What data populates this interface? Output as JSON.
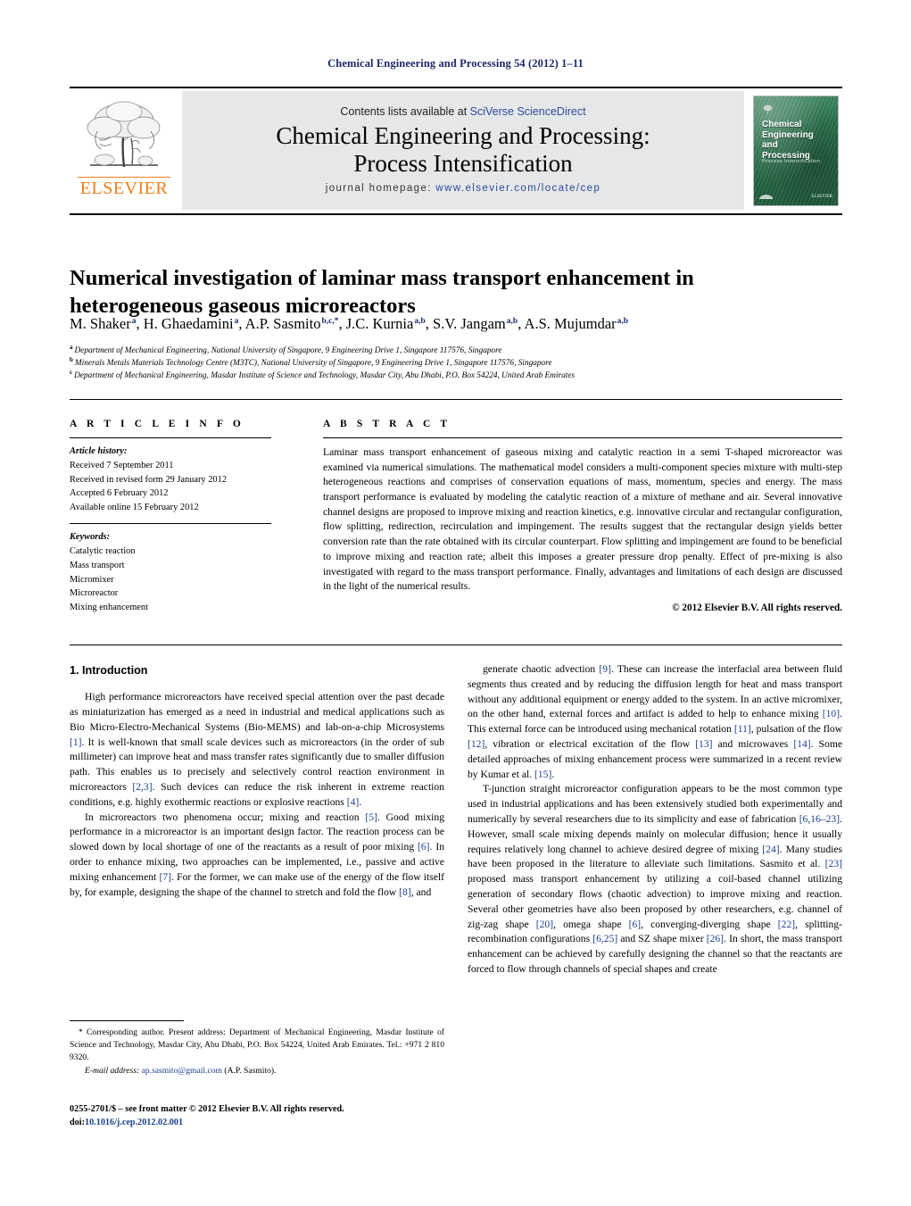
{
  "running_head": "Chemical Engineering and Processing 54 (2012) 1–11",
  "masthead": {
    "publisher_name": "ELSEVIER",
    "contents_prefix": "Contents lists available at ",
    "contents_link": "SciVerse ScienceDirect",
    "journal_title_line1": "Chemical Engineering and Processing:",
    "journal_title_line2": "Process Intensification",
    "homepage_label": "journal homepage:",
    "homepage_url": "www.elsevier.com/locate/cep",
    "cover": {
      "title_line1": "Chemical",
      "title_line2": "Engineering",
      "title_line3": "and",
      "title_line4": "Processing",
      "subtitle": "Process Intensification",
      "imprint": "ELSEVIER",
      "bg_color": "#2c7a52"
    }
  },
  "article": {
    "title": "Numerical investigation of laminar mass transport enhancement in heterogeneous gaseous microreactors",
    "authors_html": "M. Shaker<sup>a</sup>, H. Ghaedamini<sup>a</sup>, A.P. Sasmito<sup>b,c,*</sup>, J.C. Kurnia<sup>a,b</sup>, S.V. Jangam<sup>a,b</sup>, A.S. Mujumdar<sup>a,b</sup>",
    "affiliations": [
      {
        "marker": "a",
        "text": "Department of Mechanical Engineering, National University of Singapore, 9 Engineering Drive 1, Singapore 117576, Singapore"
      },
      {
        "marker": "b",
        "text": "Minerals Metals Materials Technology Centre (M3TC), National University of Singapore, 9 Engineering Drive 1, Singapore 117576, Singapore"
      },
      {
        "marker": "c",
        "text": "Department of Mechanical Engineering, Masdar Institute of Science and Technology, Masdar City, Abu Dhabi, P.O. Box 54224, United Arab Emirates"
      }
    ]
  },
  "article_info": {
    "heading": "A R T I C L E    I N F O",
    "history_label": "Article history:",
    "history": [
      "Received 7 September 2011",
      "Received in revised form 29 January 2012",
      "Accepted 6 February 2012",
      "Available online 15 February 2012"
    ],
    "keywords_label": "Keywords:",
    "keywords": [
      "Catalytic reaction",
      "Mass transport",
      "Micromixer",
      "Microreactor",
      "Mixing enhancement"
    ]
  },
  "abstract": {
    "heading": "A B S T R A C T",
    "text": "Laminar mass transport enhancement of gaseous mixing and catalytic reaction in a semi T-shaped microreactor was examined via numerical simulations. The mathematical model considers a multi-component species mixture with multi-step heterogeneous reactions and comprises of conservation equations of mass, momentum, species and energy. The mass transport performance is evaluated by modeling the catalytic reaction of a mixture of methane and air. Several innovative channel designs are proposed to improve mixing and reaction kinetics, e.g. innovative circular and rectangular configuration, flow splitting, redirection, recirculation and impingement. The results suggest that the rectangular design yields better conversion rate than the rate obtained with its circular counterpart. Flow splitting and impingement are found to be beneficial to improve mixing and reaction rate; albeit this imposes a greater pressure drop penalty. Effect of pre-mixing is also investigated with regard to the mass transport performance. Finally, advantages and limitations of each design are discussed in the light of the numerical results.",
    "copyright": "© 2012 Elsevier B.V. All rights reserved."
  },
  "body": {
    "section_number_title": "1.  Introduction",
    "left_paragraphs": [
      "High performance microreactors have received special attention over the past decade as miniaturization has emerged as a need in industrial and medical applications such as Bio Micro-Electro-Mechanical Systems (Bio-MEMS) and lab-on-a-chip Microsystems [1]. It is well-known that small scale devices such as microreactors (in the order of sub millimeter) can improve heat and mass transfer rates significantly due to smaller diffusion path. This enables us to precisely and selectively control reaction environment in microreactors [2,3]. Such devices can reduce the risk inherent in extreme reaction conditions, e.g. highly exothermic reactions or explosive reactions [4].",
      "In microreactors two phenomena occur; mixing and reaction [5]. Good mixing performance in a microreactor is an important design factor. The reaction process can be slowed down by local shortage of one of the reactants as a result of poor mixing [6]. In order to enhance mixing, two approaches can be implemented, i.e., passive and active mixing enhancement [7]. For the former, we can make use of the energy of the flow itself by, for example, designing the shape of the channel to stretch and fold the flow [8], and"
    ],
    "right_paragraphs": [
      "generate chaotic advection [9]. These can increase the interfacial area between fluid segments thus created and by reducing the diffusion length for heat and mass transport without any additional equipment or energy added to the system. In an active micromixer, on the other hand, external forces and artifact is added to help to enhance mixing [10]. This external force can be introduced using mechanical rotation [11], pulsation of the flow [12], vibration or electrical excitation of the flow [13] and microwaves [14]. Some detailed approaches of mixing enhancement process were summarized in a recent review by Kumar et al. [15].",
      "T-junction straight microreactor configuration appears to be the most common type used in industrial applications and has been extensively studied both experimentally and numerically by several researchers due to its simplicity and ease of fabrication [6,16–23]. However, small scale mixing depends mainly on molecular diffusion; hence it usually requires relatively long channel to achieve desired degree of mixing [24]. Many studies have been proposed in the literature to alleviate such limitations. Sasmito et al. [23] proposed mass transport enhancement by utilizing a coil-based channel utilizing generation of secondary flows (chaotic advection) to improve mixing and reaction. Several other geometries have also been proposed by other researchers, e.g. channel of zig-zag shape [20], omega shape [6], converging-diverging shape [22], splitting-recombination configurations [6,25] and SZ shape mixer [26]. In short, the mass transport enhancement can be achieved by carefully designing the channel so that the reactants are forced to flow through channels of special shapes and create"
    ]
  },
  "footnote": {
    "corresponding": "* Corresponding author. Present address: Department of Mechanical Engineering, Masdar Institute of Science and Technology, Masdar City, Abu Dhabi, P.O. Box 54224, United Arab Emirates. Tel.: +971 2 810 9320.",
    "email_label": "E-mail address:",
    "email_address": "ap.sasmito@gmail.com",
    "email_owner": "(A.P. Sasmito)."
  },
  "imprint": {
    "line1": "0255-2701/$ – see front matter © 2012 Elsevier B.V. All rights reserved.",
    "doi_label": "doi:",
    "doi_value": "10.1016/j.cep.2012.02.001"
  }
}
